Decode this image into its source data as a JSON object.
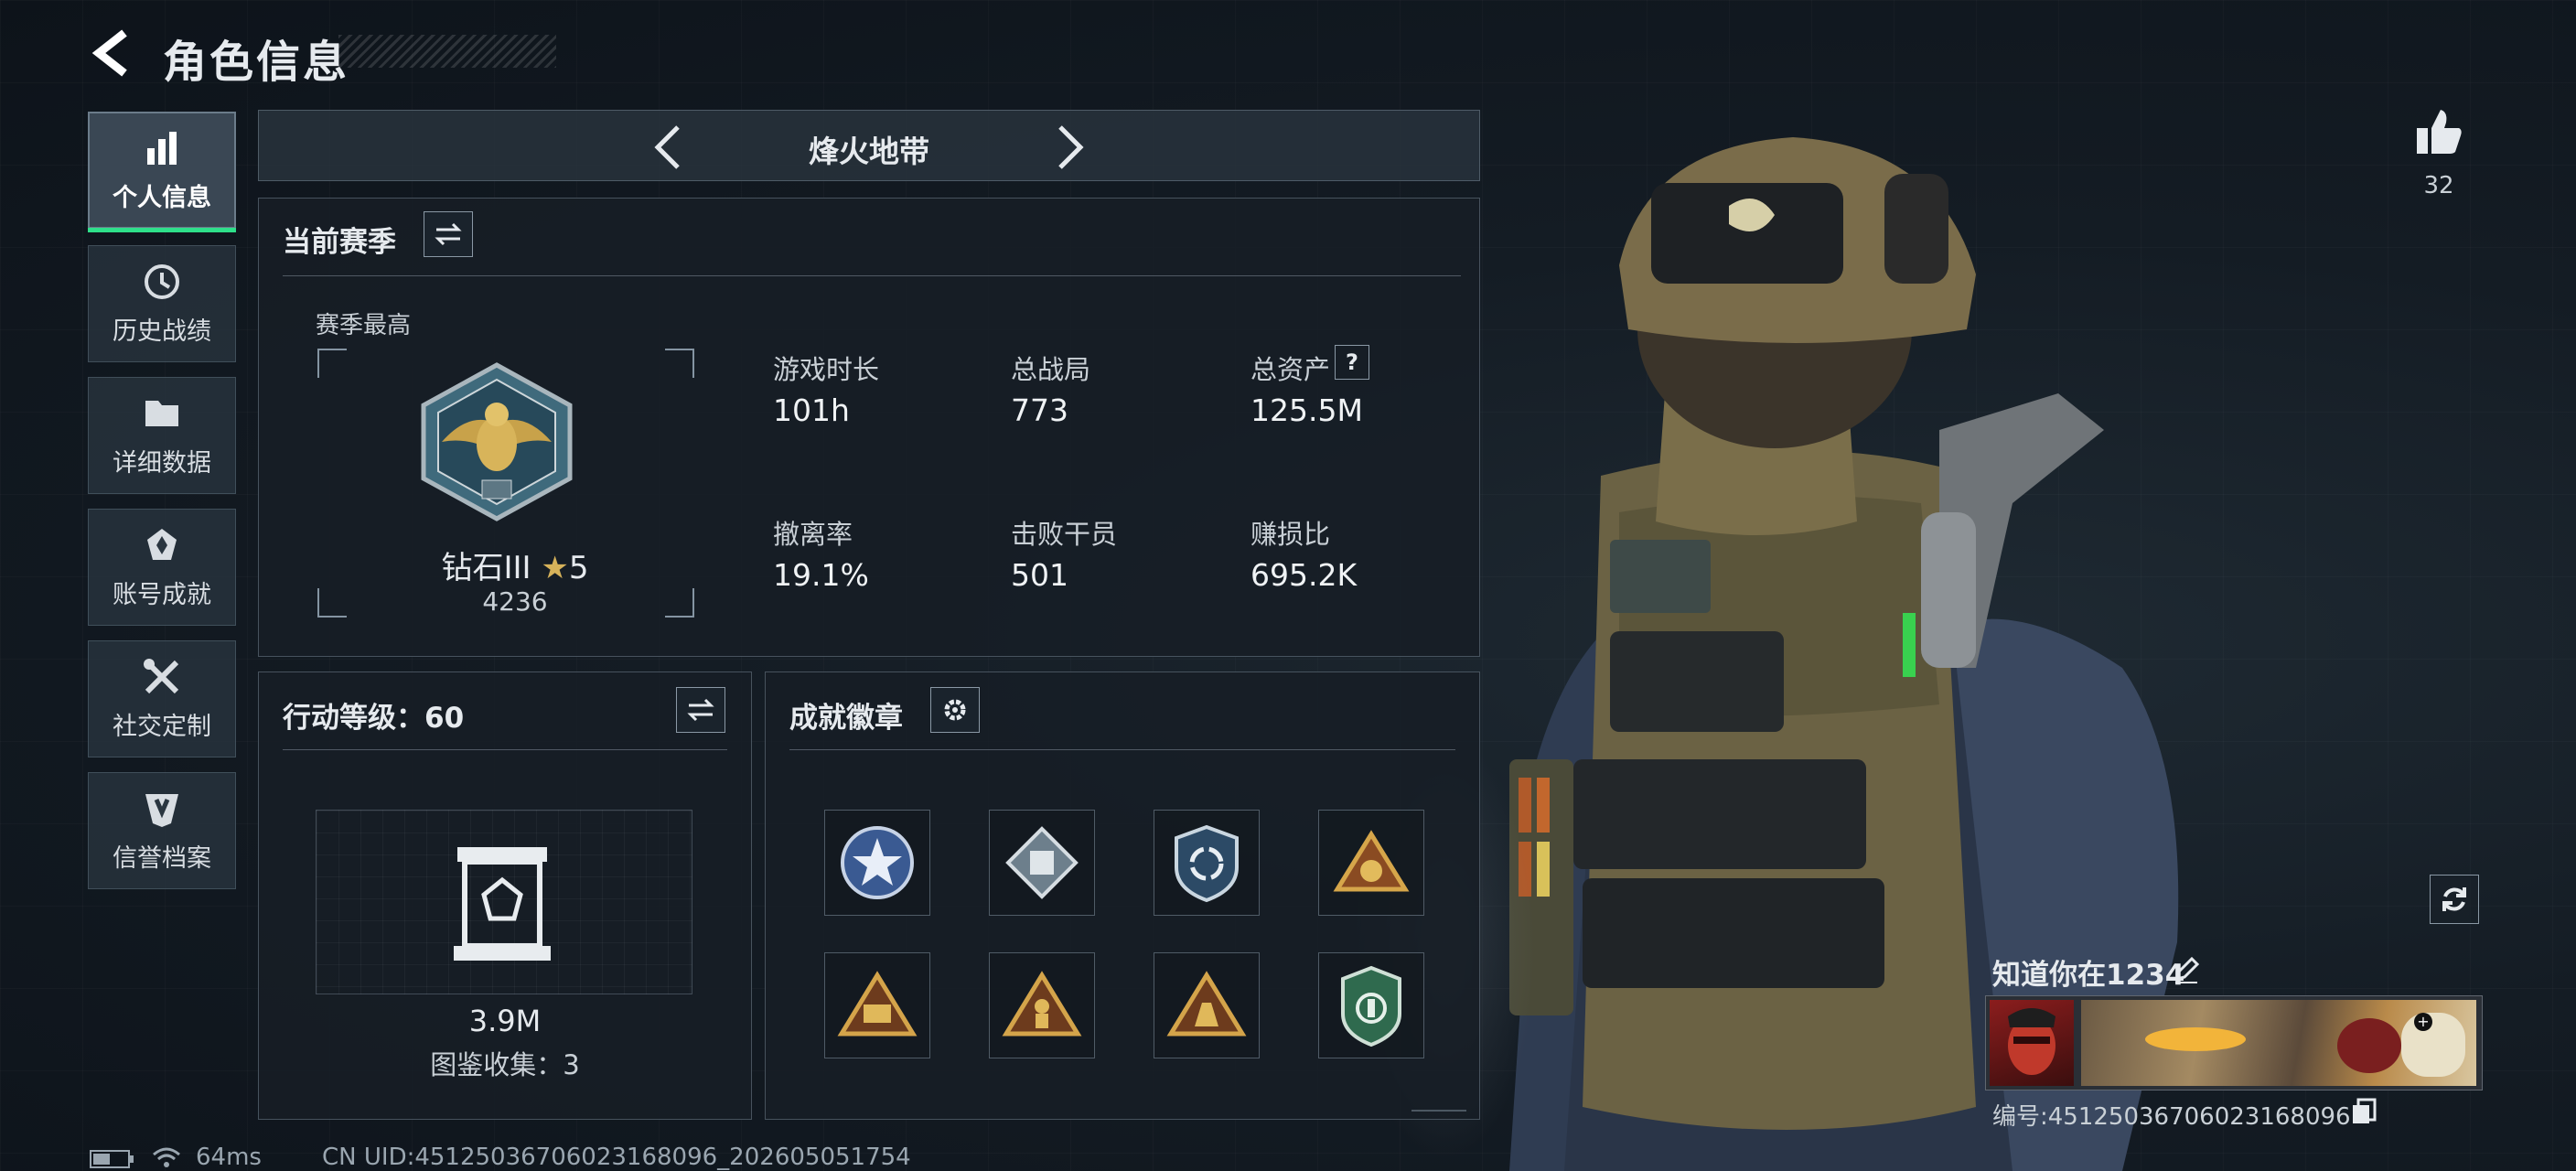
{
  "header": {
    "title": "角色信息"
  },
  "sidebar": {
    "items": [
      {
        "label": "个人信息",
        "icon": "bar-chart-icon",
        "active": true
      },
      {
        "label": "历史战绩",
        "icon": "history-icon"
      },
      {
        "label": "详细数据",
        "icon": "folder-icon"
      },
      {
        "label": "账号成就",
        "icon": "achievement-icon"
      },
      {
        "label": "社交定制",
        "icon": "tools-icon"
      },
      {
        "label": "信誉档案",
        "icon": "credit-shield-icon"
      }
    ]
  },
  "mode": {
    "title": "烽火地带"
  },
  "season": {
    "heading": "当前赛季",
    "best_label": "赛季最高",
    "rank_name": "钻石III",
    "rank_stars": "5",
    "rank_points": "4236",
    "stats": [
      {
        "label": "游戏时长",
        "value": "101h"
      },
      {
        "label": "总战局",
        "value": "773"
      },
      {
        "label": "总资产",
        "value": "125.5M",
        "help": "?"
      },
      {
        "label": "撤离率",
        "value": "19.1%"
      },
      {
        "label": "击败干员",
        "value": "501"
      },
      {
        "label": "赚损比",
        "value": "695.2K"
      }
    ]
  },
  "action_level": {
    "heading": "行动等级：60",
    "value": "3.9M",
    "collection": "图鉴收集：3"
  },
  "achievements": {
    "heading": "成就徽章",
    "badges": [
      "police-star-badge",
      "diamond-badge",
      "shield-recycle-badge",
      "golden-triangle-badge",
      "warrior-triangle-badge",
      "figure-triangle-badge",
      "hand-triangle-badge",
      "green-shield-badge"
    ]
  },
  "likes": {
    "count": "32"
  },
  "profile": {
    "name": "知道你在1234",
    "id_text": "编号:451250367060231680​96"
  },
  "footer": {
    "ping": "64ms",
    "uid": "CN UID:45125036706023168096_202605051754"
  },
  "colors": {
    "accent": "#2ee08a",
    "gold": "#c8a24a"
  }
}
